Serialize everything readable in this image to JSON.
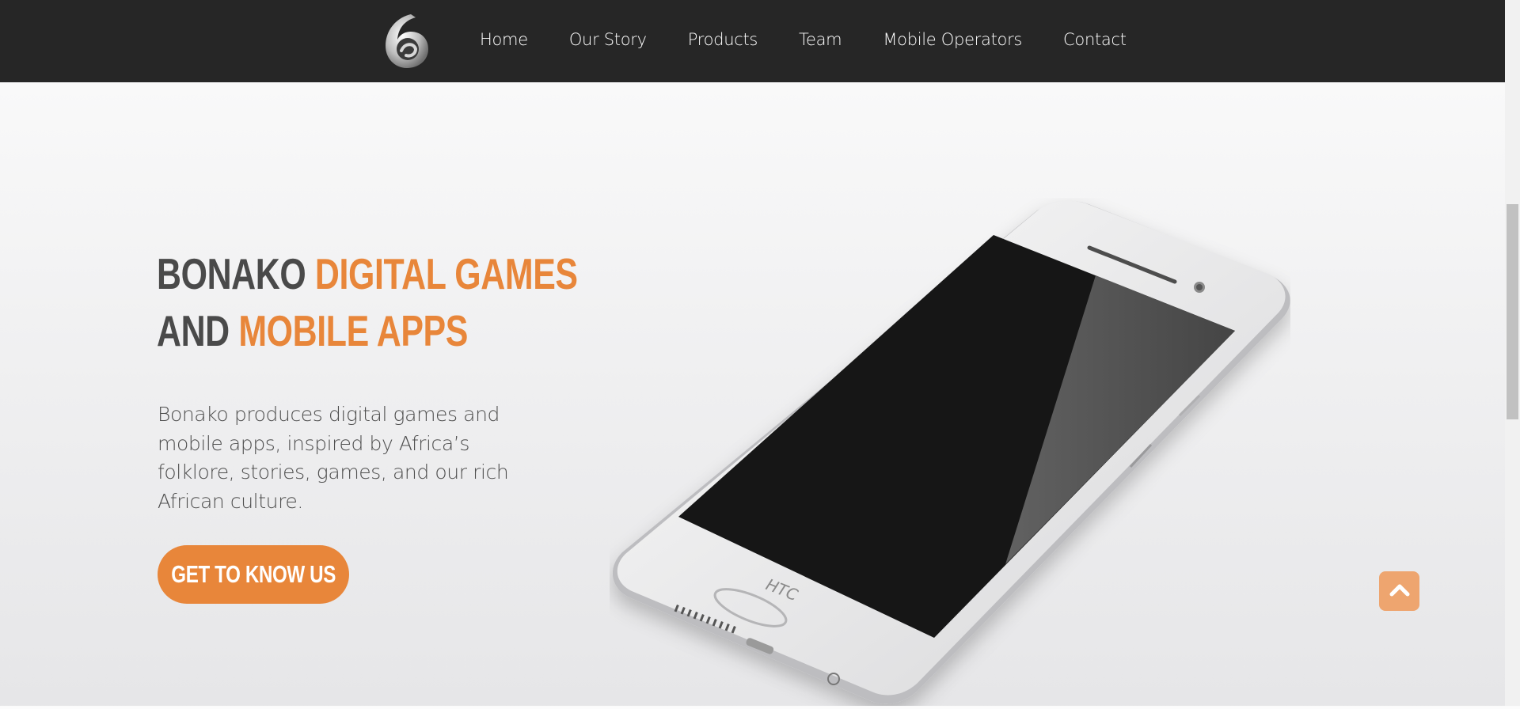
{
  "nav": {
    "logo": "bonako-logo",
    "items": [
      "Home",
      "Our Story",
      "Products",
      "Team",
      "Mobile Operators",
      "Contact"
    ]
  },
  "hero": {
    "title_line1_plain": "BONAKO ",
    "title_line1_accent": "DIGITAL GAMES",
    "title_line2_plain": "AND ",
    "title_line2_accent": "MOBILE APPS",
    "description": "Bonako produces digital games and mobile apps, inspired by Africa’s folklore, stories, games, and our rich African culture.",
    "cta_label": "GET TO KNOW US",
    "phone_brand": "HTC"
  },
  "scroll_top_icon": "chevron-up-icon",
  "colors": {
    "navbar": "#262626",
    "accent": "#e8863a",
    "heading": "#4a4a4a",
    "scroll_button": "#eea56f"
  }
}
